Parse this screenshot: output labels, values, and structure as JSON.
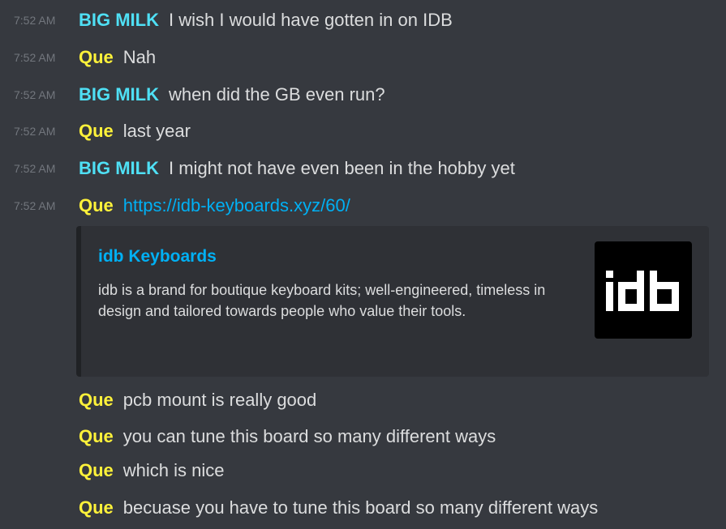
{
  "colors": {
    "background": "#36393f",
    "timestamp": "#72767d",
    "message_text": "#dcddde",
    "link": "#00b0f4",
    "embed_background": "#2f3136",
    "embed_border": "#202225",
    "author_big_milk": "#4fe0f5",
    "author_que": "#fff23a"
  },
  "messages": [
    {
      "time": "7:52 AM",
      "author": "BIG MILK",
      "text": "I wish I would have gotten in on IDB"
    },
    {
      "time": "7:52 AM",
      "author": "Que",
      "text": "Nah"
    },
    {
      "time": "7:52 AM",
      "author": "BIG MILK",
      "text": "when did the GB even run?"
    },
    {
      "time": "7:52 AM",
      "author": "Que",
      "text": "last year"
    },
    {
      "time": "7:52 AM",
      "author": "BIG MILK",
      "text": "I might not have even been in the hobby yet"
    },
    {
      "time": "7:52 AM",
      "author": "Que",
      "link": "https://idb-keyboards.xyz/60/"
    },
    {
      "author": "Que",
      "text": "pcb mount is really good"
    },
    {
      "author": "Que",
      "text": "you can tune this board so many different ways"
    },
    {
      "author": "Que",
      "text": "which is nice"
    },
    {
      "author": "Que",
      "text": "becuase you have to tune this board so many different ways"
    }
  ],
  "embed": {
    "title": "idb Keyboards",
    "description": "idb is a brand for boutique keyboard kits; well-engineered, timeless in design and tailored towards people who value their tools.",
    "thumbnail_logo_text": "idb",
    "thumbnail_icon": "idb-logo-icon"
  }
}
